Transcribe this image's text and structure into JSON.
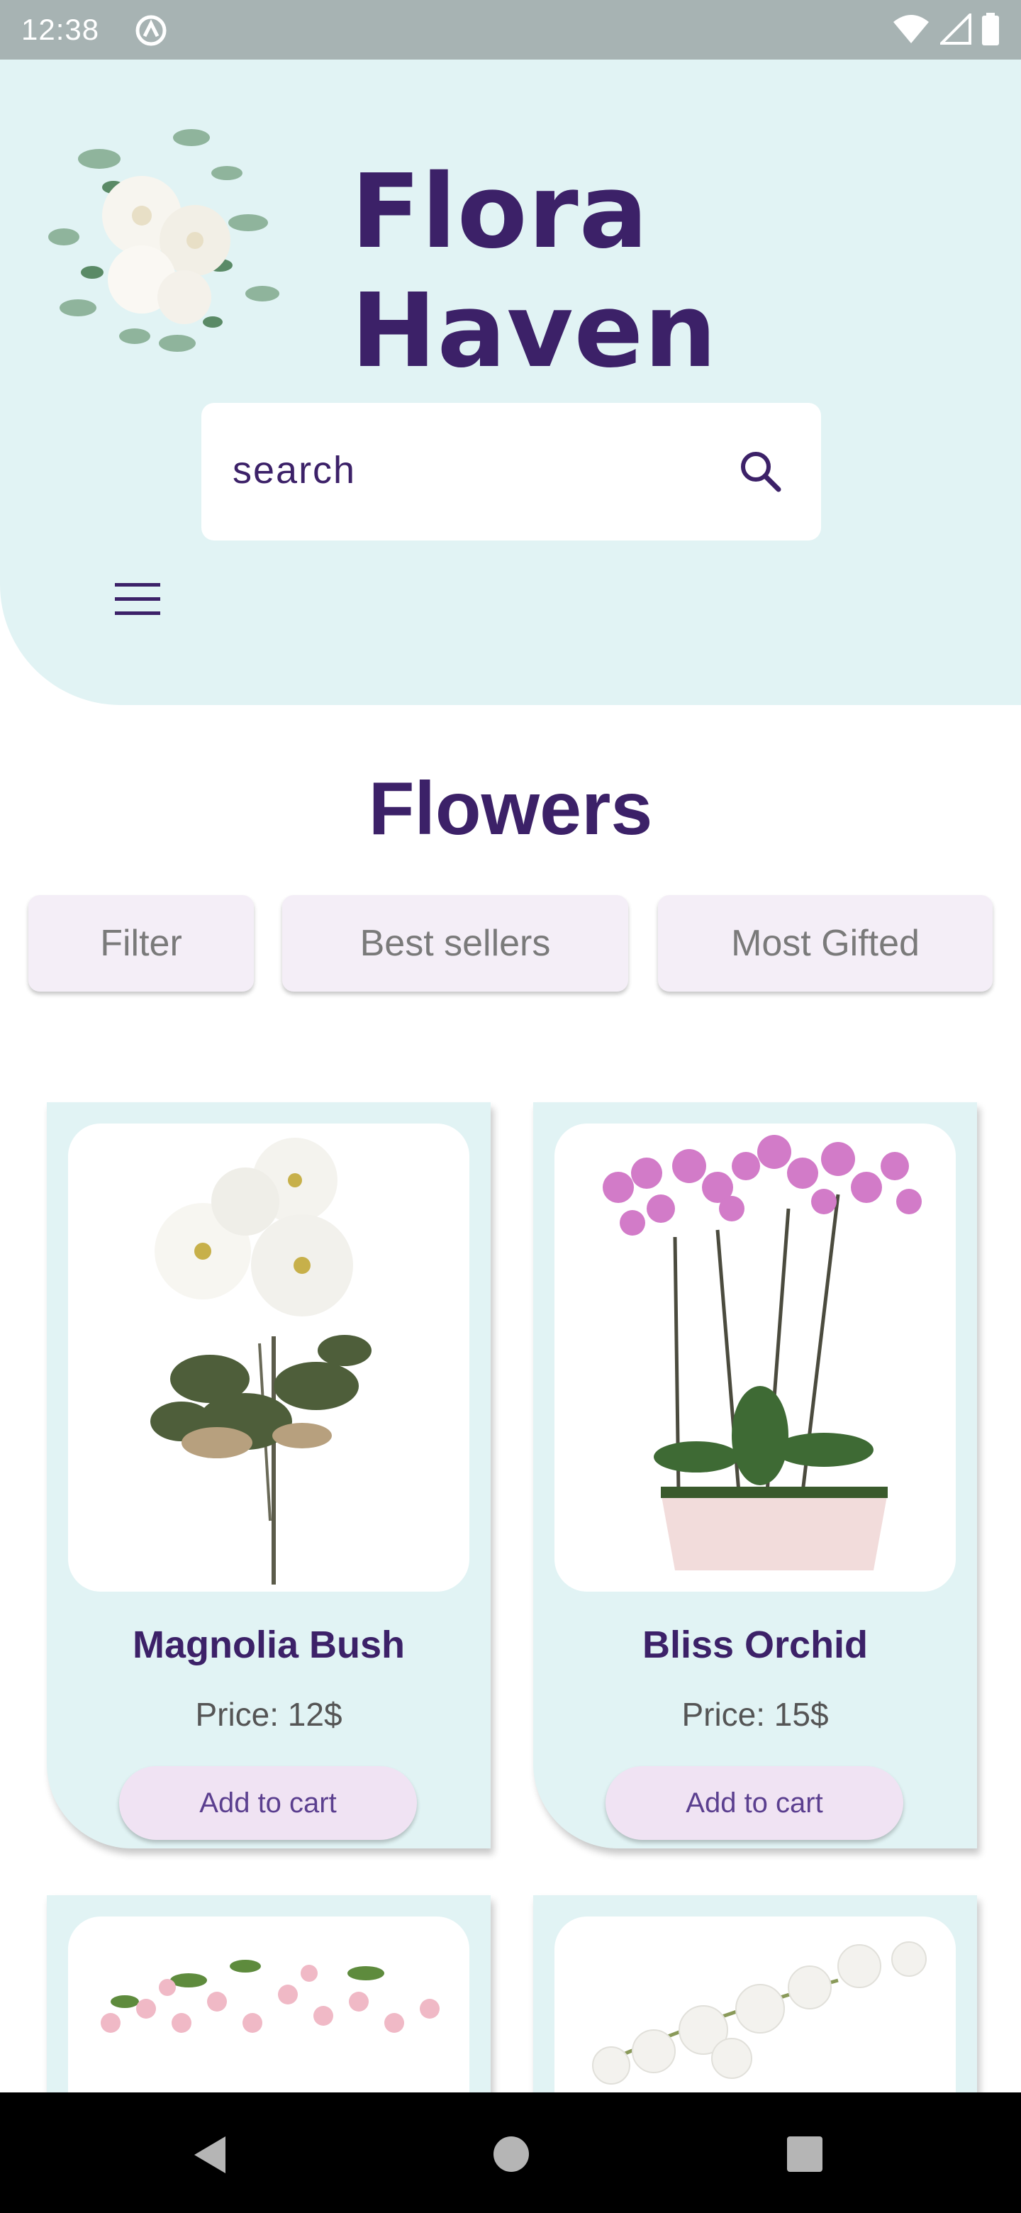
{
  "status_bar": {
    "time": "12:38"
  },
  "header": {
    "brand": "Flora Haven",
    "search": {
      "placeholder": "search"
    }
  },
  "section": {
    "title": "Flowers",
    "chips": [
      "Filter",
      "Best sellers",
      "Most Gifted"
    ]
  },
  "products": [
    {
      "name": "Magnolia Bush",
      "price": "Price: 12$",
      "cta": "Add to cart"
    },
    {
      "name": "Bliss Orchid",
      "price": "Price: 15$",
      "cta": "Add to cart"
    }
  ],
  "colors": {
    "brand_purple": "#3c2168",
    "header_bg": "#e1f3f4",
    "chip_bg": "#f4eef7",
    "cart_button_bg": "#f0e3f3"
  },
  "icons": [
    "notification-icon",
    "wifi-icon",
    "signal-icon",
    "battery-icon",
    "search-icon",
    "menu-icon",
    "back-icon",
    "home-icon",
    "recents-icon"
  ]
}
